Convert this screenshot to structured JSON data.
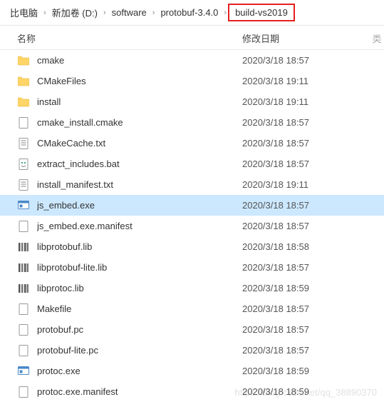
{
  "breadcrumb": {
    "items": [
      {
        "label": "比电脑",
        "highlight": false
      },
      {
        "label": "新加卷 (D:)",
        "highlight": false
      },
      {
        "label": "software",
        "highlight": false
      },
      {
        "label": "protobuf-3.4.0",
        "highlight": false
      },
      {
        "label": "build-vs2019",
        "highlight": true
      }
    ]
  },
  "columns": {
    "name": "名称",
    "date": "修改日期",
    "extra": "类"
  },
  "files": [
    {
      "icon": "folder",
      "name": "cmake",
      "date": "2020/3/18 18:57",
      "selected": false
    },
    {
      "icon": "folder",
      "name": "CMakeFiles",
      "date": "2020/3/18 19:11",
      "selected": false
    },
    {
      "icon": "folder",
      "name": "install",
      "date": "2020/3/18 19:11",
      "selected": false
    },
    {
      "icon": "file",
      "name": "cmake_install.cmake",
      "date": "2020/3/18 18:57",
      "selected": false
    },
    {
      "icon": "txt",
      "name": "CMakeCache.txt",
      "date": "2020/3/18 18:57",
      "selected": false
    },
    {
      "icon": "bat",
      "name": "extract_includes.bat",
      "date": "2020/3/18 18:57",
      "selected": false
    },
    {
      "icon": "txt",
      "name": "install_manifest.txt",
      "date": "2020/3/18 19:11",
      "selected": false
    },
    {
      "icon": "exe",
      "name": "js_embed.exe",
      "date": "2020/3/18 18:57",
      "selected": true
    },
    {
      "icon": "file",
      "name": "js_embed.exe.manifest",
      "date": "2020/3/18 18:57",
      "selected": false
    },
    {
      "icon": "lib",
      "name": "libprotobuf.lib",
      "date": "2020/3/18 18:58",
      "selected": false
    },
    {
      "icon": "lib",
      "name": "libprotobuf-lite.lib",
      "date": "2020/3/18 18:57",
      "selected": false
    },
    {
      "icon": "lib",
      "name": "libprotoc.lib",
      "date": "2020/3/18 18:59",
      "selected": false
    },
    {
      "icon": "file",
      "name": "Makefile",
      "date": "2020/3/18 18:57",
      "selected": false
    },
    {
      "icon": "file",
      "name": "protobuf.pc",
      "date": "2020/3/18 18:57",
      "selected": false
    },
    {
      "icon": "file",
      "name": "protobuf-lite.pc",
      "date": "2020/3/18 18:57",
      "selected": false
    },
    {
      "icon": "exe",
      "name": "protoc.exe",
      "date": "2020/3/18 18:59",
      "selected": false
    },
    {
      "icon": "file",
      "name": "protoc.exe.manifest",
      "date": "2020/3/18 18:59",
      "selected": false
    }
  ],
  "watermark": "https://blog.csdn.net/qq_38890370"
}
